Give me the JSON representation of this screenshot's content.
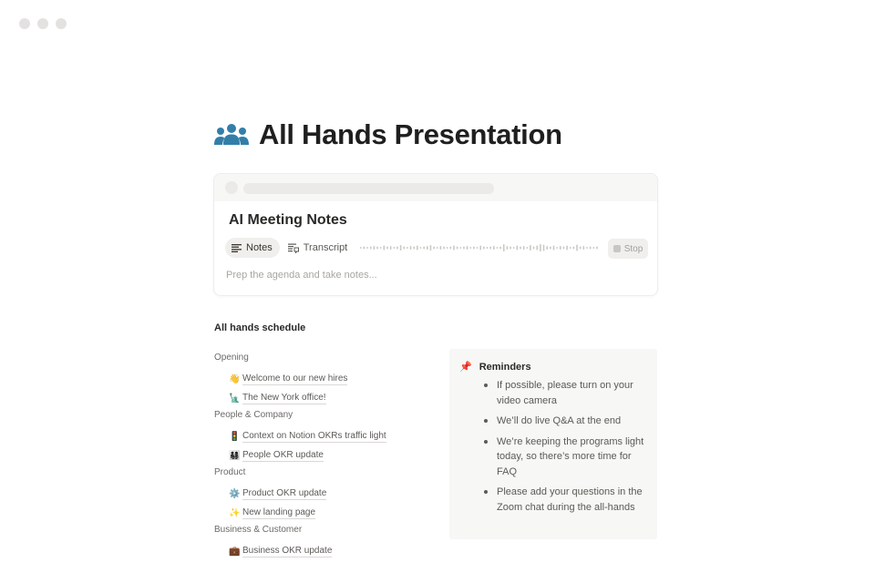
{
  "page": {
    "title": "All Hands Presentation",
    "icon": "people-group-icon",
    "icon_color": "#337ea9"
  },
  "ai_notes": {
    "title": "AI Meeting Notes",
    "tabs": [
      {
        "label": "Notes",
        "icon": "notes-lines-icon",
        "active": true
      },
      {
        "label": "Transcript",
        "icon": "transcript-icon",
        "active": false
      }
    ],
    "stop_label": "Stop",
    "placeholder": "Prep the agenda and take notes..."
  },
  "schedule": {
    "heading": "All hands schedule",
    "sections": [
      {
        "label": "Opening",
        "items": [
          {
            "emoji": "👋",
            "label": "Welcome to our new hires"
          },
          {
            "emoji": "🗽",
            "label": "The New York office!"
          }
        ]
      },
      {
        "label": "People & Company",
        "items": [
          {
            "emoji": "🚦",
            "label": "Context on Notion OKRs traffic light"
          },
          {
            "emoji": "👨‍👩‍👧‍👦",
            "label": "People OKR update"
          }
        ]
      },
      {
        "label": "Product",
        "items": [
          {
            "emoji": "⚙️",
            "label": "Product OKR update"
          },
          {
            "emoji": "✨",
            "label": "New landing page"
          }
        ]
      },
      {
        "label": "Business & Customer",
        "items": [
          {
            "emoji": "💼",
            "label": "Business OKR update"
          }
        ]
      }
    ]
  },
  "reminders": {
    "icon": "pushpin-icon",
    "title": "Reminders",
    "items": [
      "If possible, please turn on your video camera",
      "We’ll do live Q&A at the end",
      "We’re keeping the programs light today, so there’s more time for FAQ",
      "Please add your questions in the Zoom chat during the all-hands"
    ]
  }
}
